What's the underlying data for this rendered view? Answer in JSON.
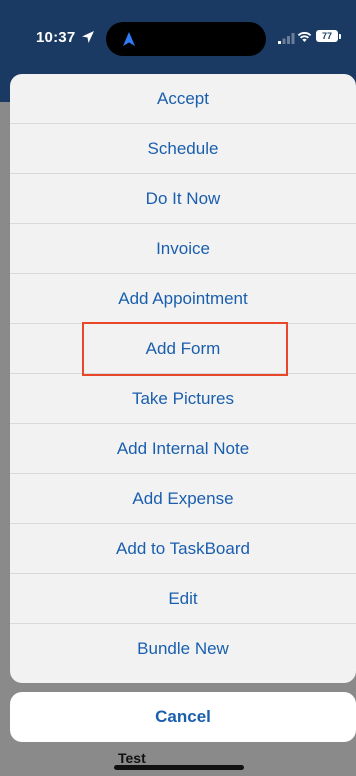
{
  "status_bar": {
    "time": "10:37",
    "battery": "77"
  },
  "sheet": {
    "actions": [
      "Accept",
      "Schedule",
      "Do It Now",
      "Invoice",
      "Add Appointment",
      "Add Form",
      "Take Pictures",
      "Add Internal Note",
      "Add Expense",
      "Add to TaskBoard",
      "Edit",
      "Bundle New"
    ],
    "cancel_label": "Cancel"
  },
  "background": {
    "text": "Test"
  },
  "colors": {
    "action_text": "#1a5fae",
    "status_bar_bg": "#1a3a63",
    "highlight_border": "#e8472a"
  }
}
